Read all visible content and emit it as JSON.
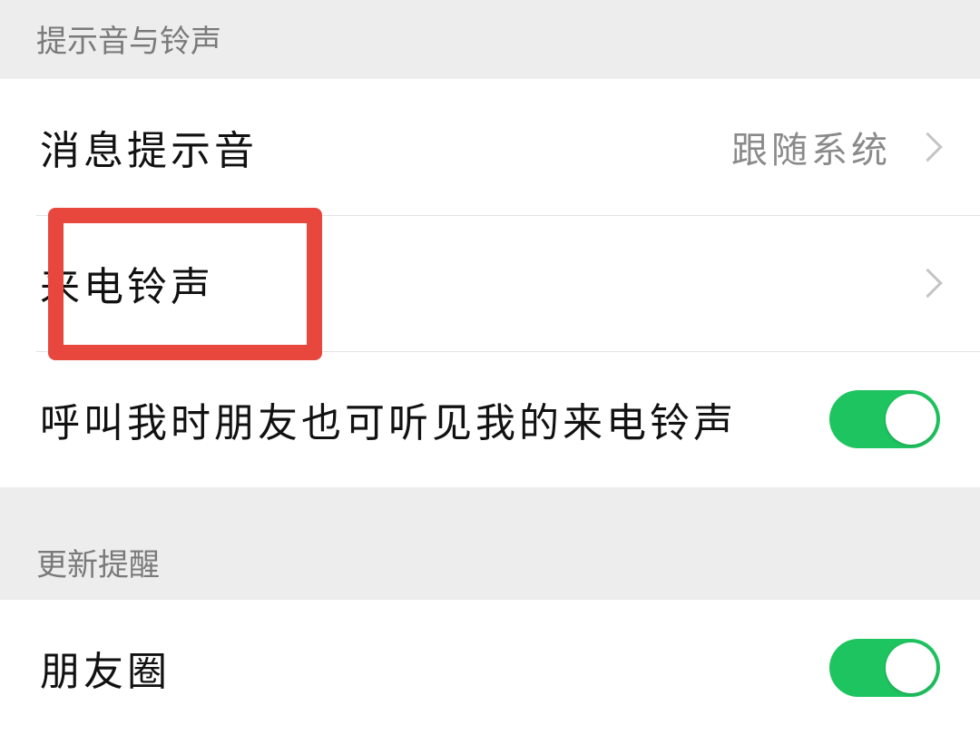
{
  "sections": {
    "sounds": {
      "header": "提示音与铃声",
      "rows": [
        {
          "label": "消息提示音",
          "value": "跟随系统"
        },
        {
          "label": "来电铃声"
        },
        {
          "label": "呼叫我时朋友也可听见我的来电铃声",
          "toggle_on": true
        }
      ]
    },
    "updates": {
      "header": "更新提醒",
      "rows": [
        {
          "label": "朋友圈",
          "toggle_on": true
        }
      ]
    }
  },
  "colors": {
    "toggle_on": "#1ec45f",
    "highlight": "#e8473d",
    "page_background": "#ededed"
  },
  "icons": {
    "chevron": "chevron-right-icon"
  }
}
